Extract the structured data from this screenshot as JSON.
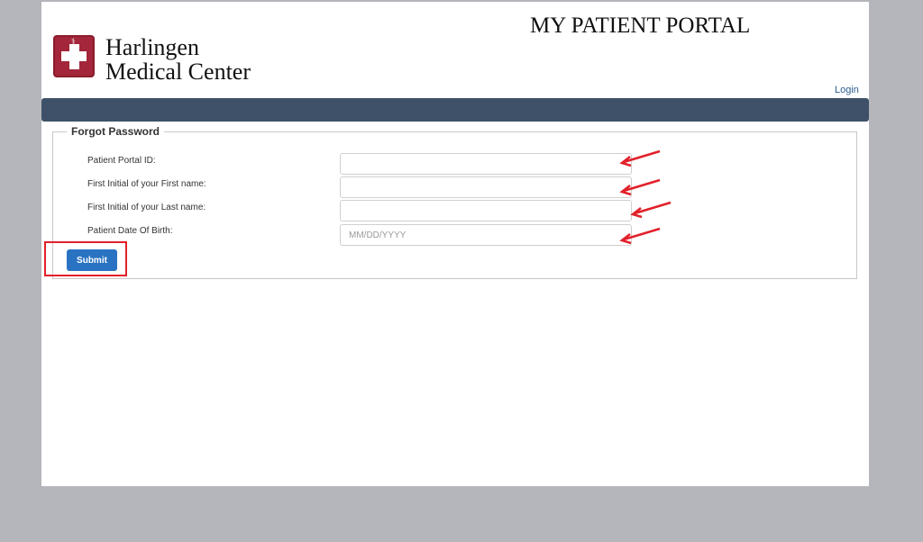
{
  "header": {
    "logo_line1": "Harlingen",
    "logo_line2": "Medical Center",
    "portal_title": "MY PATIENT PORTAL",
    "login_link": "Login"
  },
  "form": {
    "legend": "Forgot Password",
    "fields": [
      {
        "label": "Patient Portal ID:",
        "value": "",
        "placeholder": ""
      },
      {
        "label": "First Initial of your First name:",
        "value": "",
        "placeholder": ""
      },
      {
        "label": "First Initial of your Last name:",
        "value": "",
        "placeholder": ""
      },
      {
        "label": "Patient Date Of Birth:",
        "value": "",
        "placeholder": "MM/DD/YYYY"
      }
    ],
    "submit_label": "Submit"
  },
  "colors": {
    "navbar": "#3e5168",
    "submit": "#2a73c2",
    "annotation": "#e2202a",
    "logo": "#a3263a"
  },
  "icons": [
    "hospital-cross-icon",
    "red-arrow-annotation",
    "red-box-annotation"
  ]
}
